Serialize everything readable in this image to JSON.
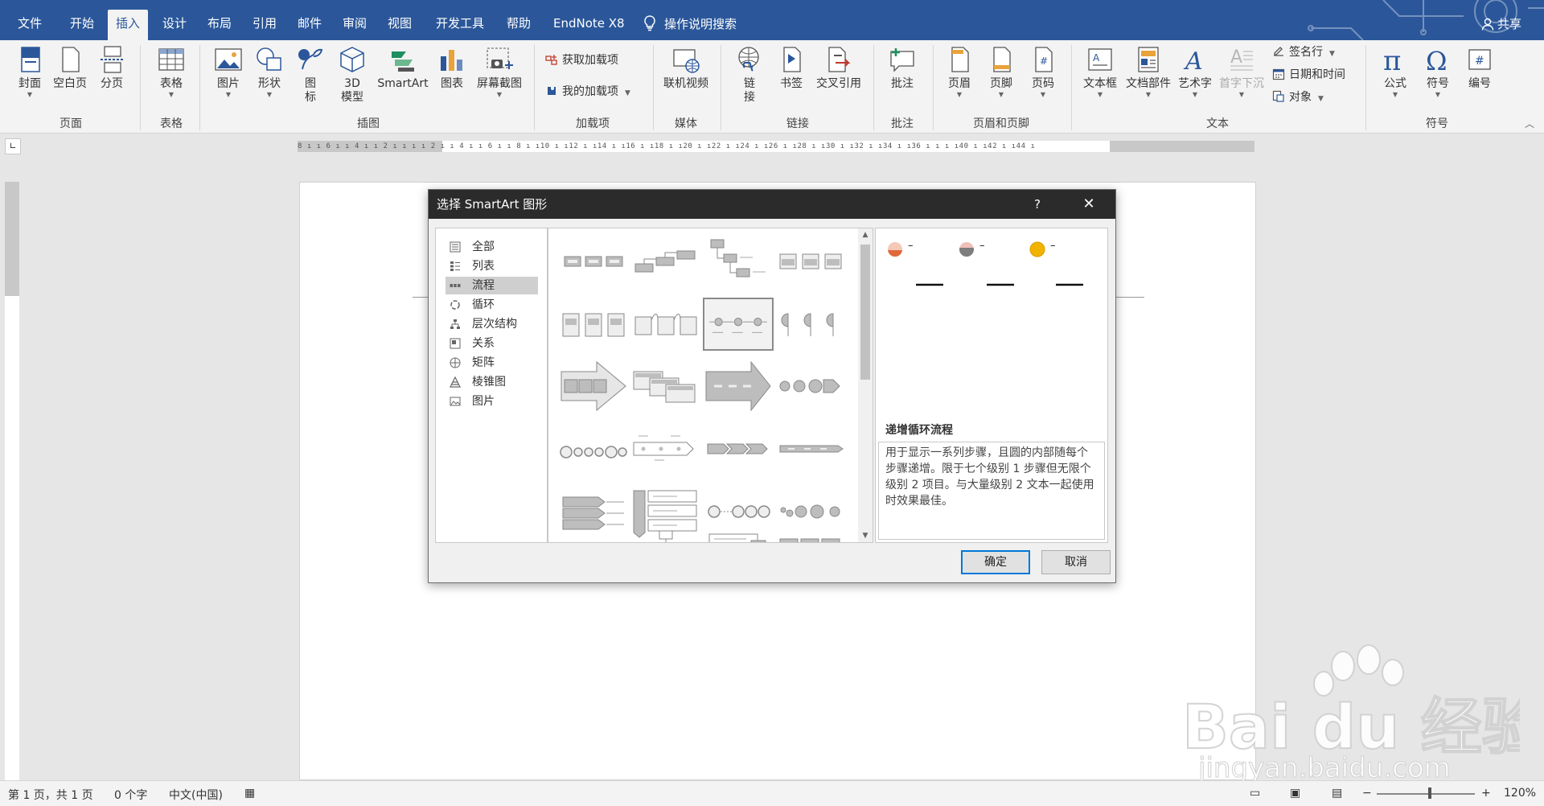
{
  "tabs": [
    "文件",
    "开始",
    "插入",
    "设计",
    "布局",
    "引用",
    "邮件",
    "审阅",
    "视图",
    "开发工具",
    "帮助",
    "EndNote X8"
  ],
  "active_tab": "插入",
  "search_label": "操作说明搜索",
  "share_label": "共享",
  "ribbon": {
    "page": {
      "label": "页面",
      "cover": "封面",
      "blank": "空白页",
      "break": "分页"
    },
    "table": {
      "label": "表格",
      "table": "表格"
    },
    "illustrations": {
      "label": "插图",
      "pictures": "图片",
      "shapes": "形状",
      "icons_1": "图",
      "icons_2": "标",
      "model_1": "3D",
      "model_2": "模型",
      "smartart": "SmartArt",
      "chart": "图表",
      "screenshot": "屏幕截图"
    },
    "addins": {
      "label": "加载项",
      "get": "获取加载项",
      "mine": "我的加载项"
    },
    "media": {
      "label": "媒体",
      "video": "联机视频"
    },
    "links": {
      "label": "链接",
      "link_1": "链",
      "link_2": "接",
      "bookmark": "书签",
      "crossref": "交叉引用"
    },
    "comments": {
      "label": "批注",
      "comment": "批注"
    },
    "headerfooter": {
      "label": "页眉和页脚",
      "header": "页眉",
      "footer": "页脚",
      "pagenum": "页码"
    },
    "text": {
      "label": "文本",
      "textbox": "文本框",
      "quickparts": "文档部件",
      "wordart": "艺术字",
      "dropcap": "首字下沉",
      "signature": "签名行",
      "datetime": "日期和时间",
      "object": "对象"
    },
    "symbols": {
      "label": "符号",
      "equation": "公式",
      "symbol": "符号",
      "number": "编号"
    }
  },
  "ruler_text": "8 ı ı 6 ı ı 4 ı ı 2 ı ı   ı ı 2 ı ı 4 ı ı 6 ı ı 8 ı ı10 ı ı12 ı ı14 ı ı16 ı ı18 ı ı20 ı ı22 ı ı24 ı ı26 ı ı28 ı ı30 ı ı32 ı ı34 ı ı36 ı ı   ı ı40 ı ı42 ı ı44 ı",
  "dialog": {
    "title": "选择 SmartArt 图形",
    "help": "?",
    "close": "✕",
    "categories": [
      {
        "label": "全部",
        "icon": "all-icon"
      },
      {
        "label": "列表",
        "icon": "list-icon"
      },
      {
        "label": "流程",
        "icon": "process-icon"
      },
      {
        "label": "循环",
        "icon": "cycle-icon"
      },
      {
        "label": "层次结构",
        "icon": "hierarchy-icon"
      },
      {
        "label": "关系",
        "icon": "relationship-icon"
      },
      {
        "label": "矩阵",
        "icon": "matrix-icon"
      },
      {
        "label": "棱锥图",
        "icon": "pyramid-icon"
      },
      {
        "label": "图片",
        "icon": "picture-icon"
      }
    ],
    "selected_category": "流程",
    "preview_name": "递增循环流程",
    "preview_desc": "用于显示一系列步骤，且圆的内部随每个步骤递增。限于七个级别 1 步骤但无限个级别 2 项目。与大量级别 2 文本一起使用时效果最佳。",
    "preview_dash": "–",
    "ok": "确定",
    "cancel": "取消"
  },
  "status": {
    "page": "第 1 页，共 1 页",
    "words": "0 个字",
    "lang": "中文(中国)",
    "zoom_minus": "−",
    "zoom_plus": "+",
    "zoom": "120%"
  },
  "watermark": {
    "brand": "Bai du 经验",
    "url": "jingyan.baidu.com"
  },
  "colors": {
    "accent": "#2b579a",
    "dialog_title": "#2b2b2b",
    "ok_border": "#0078d7"
  }
}
